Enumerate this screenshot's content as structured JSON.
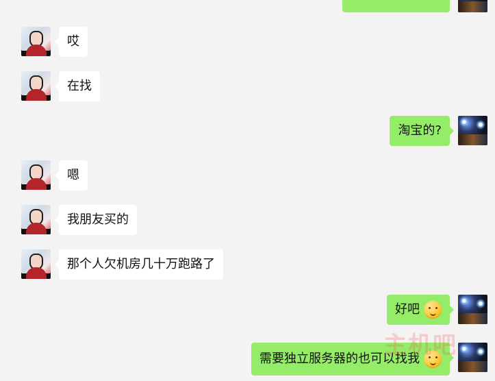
{
  "messages": [
    {
      "side": "right",
      "text": ""
    },
    {
      "side": "left",
      "text": "哎"
    },
    {
      "side": "left",
      "text": "在找"
    },
    {
      "side": "right",
      "text": "淘宝的?"
    },
    {
      "side": "left",
      "text": "嗯"
    },
    {
      "side": "left",
      "text": "我朋友买的"
    },
    {
      "side": "left",
      "text": "那个人欠机房几十万跑路了"
    },
    {
      "side": "right",
      "text": "好吧",
      "emoji": "worried-face-emoji"
    },
    {
      "side": "right",
      "text": "需要独立服务器的也可以找我",
      "emoji": "smiling-face-emoji"
    }
  ],
  "watermark": {
    "text": "主机吧"
  },
  "colors": {
    "background": "#f3f3f3",
    "incoming": "#ffffff",
    "outgoing": "#95ec69",
    "text": "#111111"
  }
}
